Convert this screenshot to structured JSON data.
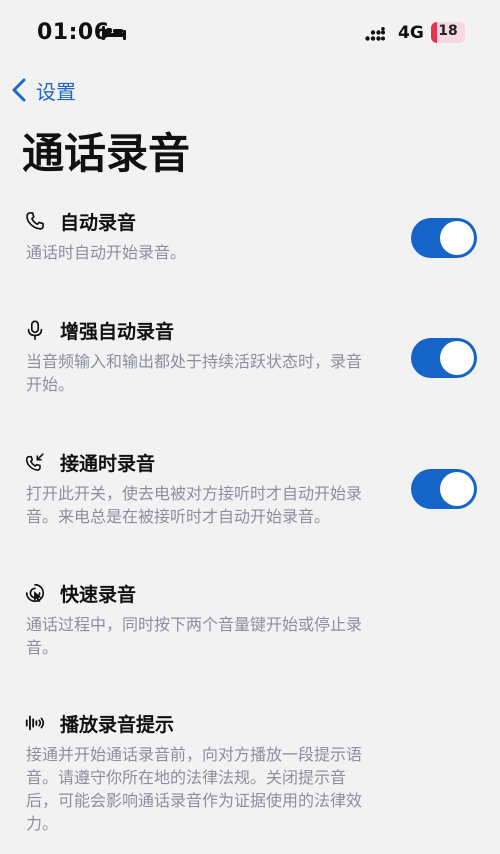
{
  "status_bar": {
    "time": "01:06",
    "network": "4G",
    "battery": {
      "level": 18,
      "label": "18"
    }
  },
  "nav": {
    "back_label": "设置"
  },
  "page_title": "通话录音",
  "colors": {
    "accent": "#1565c8",
    "battery_low": "#e8334f"
  },
  "items": [
    {
      "icon": "phone-icon",
      "title": "自动录音",
      "description": "通话时自动开始录音。",
      "enabled": true
    },
    {
      "icon": "microphone-icon",
      "title": "增强自动录音",
      "description": "当音频输入和输出都处于持续活跃状态时，录音开始。",
      "enabled": true
    },
    {
      "icon": "phone-incoming-icon",
      "title": "接通时录音",
      "description": "打开此开关，使去电被对方接听时才自动开始录音。来电总是在被接听时才自动开始录音。",
      "enabled": true
    },
    {
      "icon": "quick-record-icon",
      "title": "快速录音",
      "description": "通话过程中，同时按下两个音量键开始或停止录音。",
      "enabled": false
    },
    {
      "icon": "sound-wave-icon",
      "title": "播放录音提示",
      "description": "接通并开始通话录音前，向对方播放一段提示语音。请遵守你所在地的法律法规。关闭提示音后，可能会影响通话录音作为证据使用的法律效力。",
      "enabled": false
    }
  ]
}
